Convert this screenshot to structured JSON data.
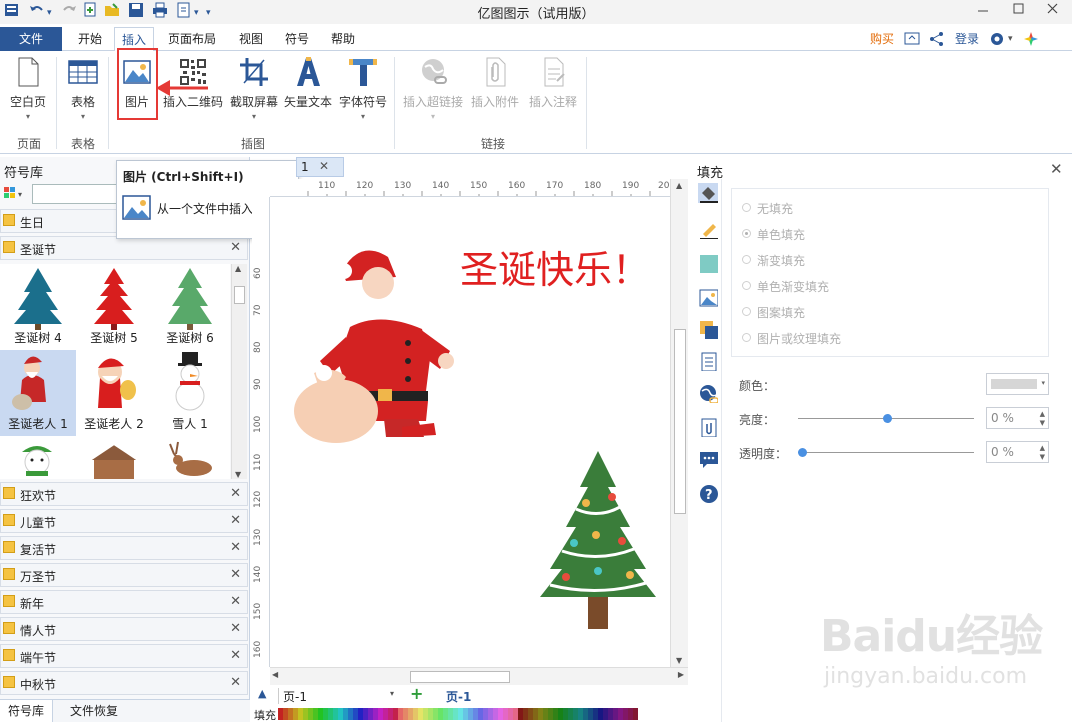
{
  "window": {
    "title": "亿图图示（试用版）",
    "minimize_icon": "minimize-icon",
    "maximize_icon": "maximize-icon",
    "close_icon": "close-icon"
  },
  "menu": {
    "file": "文件",
    "tabs": [
      "开始",
      "插入",
      "页面布局",
      "视图",
      "符号",
      "帮助"
    ],
    "active_tab": "插入",
    "buy": "购买",
    "login": "登录",
    "buy_color": "#e36c09"
  },
  "ribbon": {
    "buttons": {
      "blank_page": "空白页",
      "table": "表格",
      "picture": "图片",
      "qrcode": "插入二维码",
      "screenshot": "截取屏幕",
      "vector_text": "矢量文本",
      "font_symbol": "字体符号",
      "hyperlink": "插入超链接",
      "attachment": "插入附件",
      "comment": "插入注释"
    },
    "groups": {
      "page": "页面",
      "table": "表格",
      "illustration": "插图",
      "link": "链接"
    }
  },
  "tooltip": {
    "title": "图片 (Ctrl+Shift+I)",
    "description": "从一个文件中插入图片。"
  },
  "library": {
    "title": "符号库",
    "categories_top": [
      {
        "name": "生日",
        "closable": false
      },
      {
        "name": "圣诞节",
        "closable": true
      }
    ],
    "shapes": [
      "圣诞树 4",
      "圣诞树 5",
      "圣诞树 6",
      "圣诞老人 1",
      "圣诞老人 2",
      "雪人 1"
    ],
    "selected_shape": "圣诞老人 1",
    "categories_bottom": [
      "狂欢节",
      "儿童节",
      "复活节",
      "万圣节",
      "新年",
      "情人节",
      "端午节",
      "中秋节"
    ],
    "bottom_tabs": [
      "符号库",
      "文件恢复"
    ]
  },
  "canvas": {
    "doc_tab": "1",
    "heading": "圣诞快乐！",
    "heading_color": "#e02020",
    "ruler_h": [
      "110",
      "120",
      "130",
      "140",
      "150",
      "160",
      "170",
      "180",
      "190",
      "20"
    ],
    "ruler_v": [
      "60",
      "70",
      "80",
      "90",
      "100",
      "110",
      "120",
      "130",
      "140",
      "150",
      "160"
    ]
  },
  "pages": {
    "current": "页-1",
    "tab": "页-1",
    "fill_label": "填充"
  },
  "fill_panel": {
    "title": "填充",
    "options": [
      "无填充",
      "单色填充",
      "渐变填充",
      "单色渐变填充",
      "图案填充",
      "图片或纹理填充"
    ],
    "selected_option": "单色填充",
    "color_label": "颜色：",
    "brightness_label": "亮度：",
    "brightness_value": "0 %",
    "transparency_label": "透明度：",
    "transparency_value": "0 %",
    "swatch_color": "#d6d6d6"
  },
  "watermark": {
    "brand": "Baidu经验",
    "url": "jingyan.baidu.com"
  }
}
